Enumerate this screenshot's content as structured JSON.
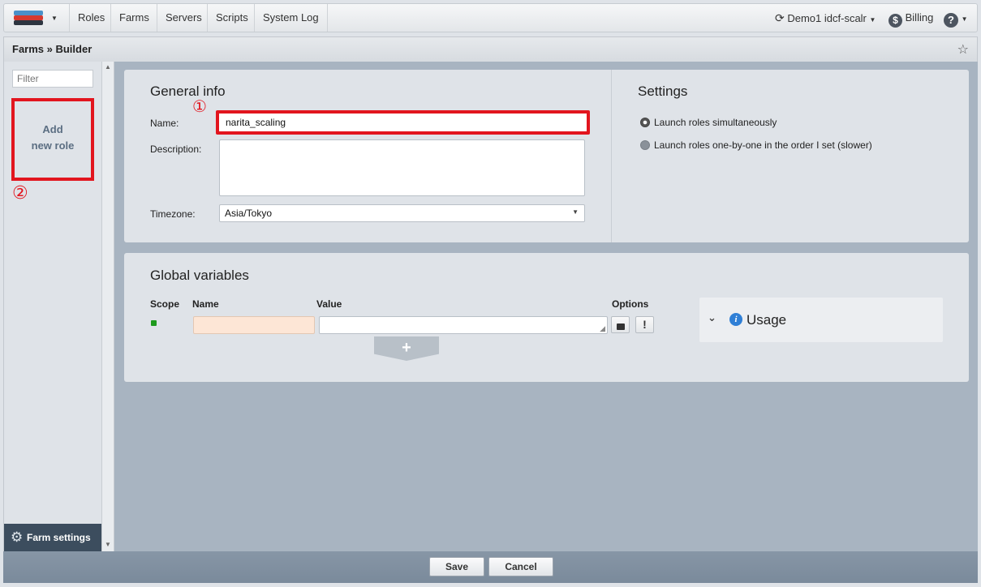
{
  "nav": {
    "items": [
      "Roles",
      "Farms",
      "Servers",
      "Scripts",
      "System Log"
    ],
    "account": "Demo1 idcf-scalr",
    "billing": "Billing",
    "help_icon": "help-icon"
  },
  "header": {
    "breadcrumb": "Farms » Builder"
  },
  "sidebar": {
    "filter_placeholder": "Filter",
    "add_role_line1": "Add",
    "add_role_line2": "new role",
    "farm_settings": "Farm settings",
    "annotation_2": "②"
  },
  "general": {
    "title": "General info",
    "annotation_1": "①",
    "name_label": "Name:",
    "name_value": "narita_scaling",
    "description_label": "Description:",
    "description_value": "",
    "timezone_label": "Timezone:",
    "timezone_value": "Asia/Tokyo"
  },
  "settings": {
    "title": "Settings",
    "option_simultaneous": "Launch roles simultaneously",
    "option_sequential": "Launch roles one-by-one in the order I set (slower)",
    "selected": "simultaneous"
  },
  "globals": {
    "title": "Global variables",
    "col_scope": "Scope",
    "col_name": "Name",
    "col_value": "Value",
    "col_options": "Options",
    "add_symbol": "+",
    "usage": "Usage",
    "scope_color": "#1d9a1d"
  },
  "footer": {
    "save": "Save",
    "cancel": "Cancel"
  },
  "colors": {
    "annotation_red": "#e2151e",
    "main_bg": "#a8b4c1",
    "panel_bg": "#dfe3e8"
  }
}
